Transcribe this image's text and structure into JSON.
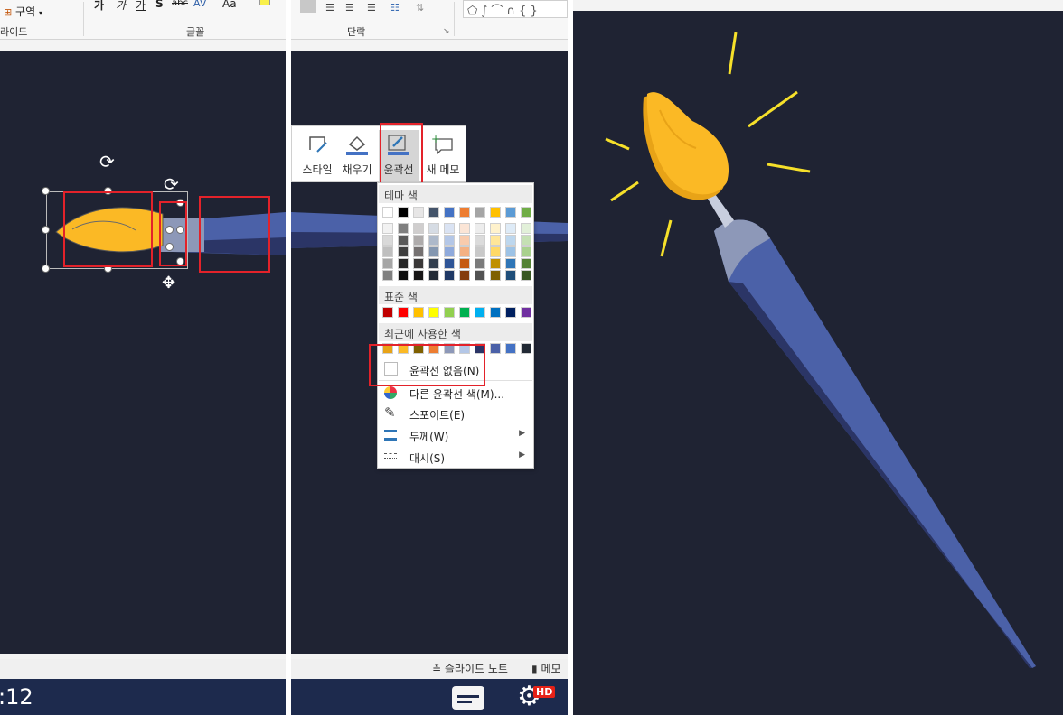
{
  "left_panel": {
    "ribbon": {
      "section_button": "구역",
      "slide_group_label": "라이드",
      "font_group_label": "글꼴",
      "font_buttons": [
        "가",
        "가",
        "가",
        "S",
        "abc",
        "AV",
        "Aa"
      ]
    },
    "status": {
      "notes_label": "슬라이드 노트"
    },
    "video": {
      "time": ":12"
    }
  },
  "mid_panel": {
    "ribbon": {
      "paragraph_group_label": "단락"
    },
    "float_toolbar": {
      "style_label": "스타일",
      "fill_label": "채우기",
      "outline_label": "윤곽선",
      "comment_label": "새 메모"
    },
    "outline_menu": {
      "theme_colors_header": "테마 색",
      "standard_colors_header": "표준 색",
      "recent_colors_header": "최근에 사용한 색",
      "no_outline_label": "윤곽선 없음(N)",
      "more_colors_label": "다른 윤곽선 색(M)...",
      "eyedropper_label": "스포이트(E)",
      "weight_label": "두께(W)",
      "dashes_label": "대시(S)"
    },
    "status": {
      "comments_label": "메모"
    },
    "video": {
      "hd_badge": "HD"
    }
  },
  "colors": {
    "slide_bg": "#1f2333",
    "brush_tip_yellow": "#fbb925",
    "brush_tip_shadow": "#e8a317",
    "handle_blue": "#4b61a8",
    "handle_dark": "#2b3566",
    "ferrule": "#8d98b8",
    "sparkle": "#f6e02a",
    "highlight_red": "#e3222a"
  },
  "theme_colors": {
    "top": [
      "#ffffff",
      "#000000",
      "#e7e6e6",
      "#44546a",
      "#4472c4",
      "#ed7d31",
      "#a5a5a5",
      "#ffc000",
      "#5b9bd5",
      "#70ad47"
    ],
    "shades": [
      [
        "#f2f2f2",
        "#d9d9d9",
        "#bfbfbf",
        "#a6a6a6",
        "#808080"
      ],
      [
        "#7f7f7f",
        "#595959",
        "#3f3f3f",
        "#262626",
        "#0d0d0d"
      ],
      [
        "#d0cece",
        "#aeabab",
        "#757171",
        "#3a3838",
        "#171616"
      ],
      [
        "#d6dce4",
        "#adb9ca",
        "#8497b0",
        "#333f4f",
        "#222a35"
      ],
      [
        "#dae3f3",
        "#b4c7e7",
        "#8faadc",
        "#2f5597",
        "#1f3864"
      ],
      [
        "#fbe5d6",
        "#f8cbad",
        "#f4b183",
        "#c55a11",
        "#843c0c"
      ],
      [
        "#ededed",
        "#dbdbdb",
        "#c9c9c9",
        "#7b7b7b",
        "#525252"
      ],
      [
        "#fff2cc",
        "#ffe699",
        "#ffd966",
        "#bf9000",
        "#7f6000"
      ],
      [
        "#deebf7",
        "#bdd7ee",
        "#9dc3e6",
        "#2e75b6",
        "#1f4e79"
      ],
      [
        "#e2f0d9",
        "#c5e0b4",
        "#a9d18e",
        "#548235",
        "#385723"
      ]
    ]
  },
  "standard_colors": [
    "#c00000",
    "#ff0000",
    "#ffc000",
    "#ffff00",
    "#92d050",
    "#00b050",
    "#00b0f0",
    "#0070c0",
    "#002060",
    "#7030a0"
  ],
  "recent_colors": [
    "#e8a317",
    "#fbb925",
    "#7f6000",
    "#ed7d31",
    "#8d98b8",
    "#b4c7e7",
    "#2b3566",
    "#4b61a8",
    "#4472c4",
    "#222a35"
  ]
}
